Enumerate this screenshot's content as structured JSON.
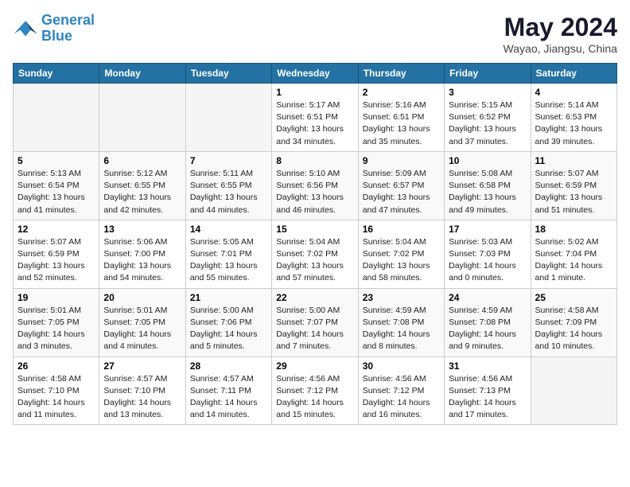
{
  "header": {
    "logo_line1": "General",
    "logo_line2": "Blue",
    "month_title": "May 2024",
    "location": "Wayao, Jiangsu, China"
  },
  "days_of_week": [
    "Sunday",
    "Monday",
    "Tuesday",
    "Wednesday",
    "Thursday",
    "Friday",
    "Saturday"
  ],
  "weeks": [
    [
      {
        "num": "",
        "info": ""
      },
      {
        "num": "",
        "info": ""
      },
      {
        "num": "",
        "info": ""
      },
      {
        "num": "1",
        "info": "Sunrise: 5:17 AM\nSunset: 6:51 PM\nDaylight: 13 hours\nand 34 minutes."
      },
      {
        "num": "2",
        "info": "Sunrise: 5:16 AM\nSunset: 6:51 PM\nDaylight: 13 hours\nand 35 minutes."
      },
      {
        "num": "3",
        "info": "Sunrise: 5:15 AM\nSunset: 6:52 PM\nDaylight: 13 hours\nand 37 minutes."
      },
      {
        "num": "4",
        "info": "Sunrise: 5:14 AM\nSunset: 6:53 PM\nDaylight: 13 hours\nand 39 minutes."
      }
    ],
    [
      {
        "num": "5",
        "info": "Sunrise: 5:13 AM\nSunset: 6:54 PM\nDaylight: 13 hours\nand 41 minutes."
      },
      {
        "num": "6",
        "info": "Sunrise: 5:12 AM\nSunset: 6:55 PM\nDaylight: 13 hours\nand 42 minutes."
      },
      {
        "num": "7",
        "info": "Sunrise: 5:11 AM\nSunset: 6:55 PM\nDaylight: 13 hours\nand 44 minutes."
      },
      {
        "num": "8",
        "info": "Sunrise: 5:10 AM\nSunset: 6:56 PM\nDaylight: 13 hours\nand 46 minutes."
      },
      {
        "num": "9",
        "info": "Sunrise: 5:09 AM\nSunset: 6:57 PM\nDaylight: 13 hours\nand 47 minutes."
      },
      {
        "num": "10",
        "info": "Sunrise: 5:08 AM\nSunset: 6:58 PM\nDaylight: 13 hours\nand 49 minutes."
      },
      {
        "num": "11",
        "info": "Sunrise: 5:07 AM\nSunset: 6:59 PM\nDaylight: 13 hours\nand 51 minutes."
      }
    ],
    [
      {
        "num": "12",
        "info": "Sunrise: 5:07 AM\nSunset: 6:59 PM\nDaylight: 13 hours\nand 52 minutes."
      },
      {
        "num": "13",
        "info": "Sunrise: 5:06 AM\nSunset: 7:00 PM\nDaylight: 13 hours\nand 54 minutes."
      },
      {
        "num": "14",
        "info": "Sunrise: 5:05 AM\nSunset: 7:01 PM\nDaylight: 13 hours\nand 55 minutes."
      },
      {
        "num": "15",
        "info": "Sunrise: 5:04 AM\nSunset: 7:02 PM\nDaylight: 13 hours\nand 57 minutes."
      },
      {
        "num": "16",
        "info": "Sunrise: 5:04 AM\nSunset: 7:02 PM\nDaylight: 13 hours\nand 58 minutes."
      },
      {
        "num": "17",
        "info": "Sunrise: 5:03 AM\nSunset: 7:03 PM\nDaylight: 14 hours\nand 0 minutes."
      },
      {
        "num": "18",
        "info": "Sunrise: 5:02 AM\nSunset: 7:04 PM\nDaylight: 14 hours\nand 1 minute."
      }
    ],
    [
      {
        "num": "19",
        "info": "Sunrise: 5:01 AM\nSunset: 7:05 PM\nDaylight: 14 hours\nand 3 minutes."
      },
      {
        "num": "20",
        "info": "Sunrise: 5:01 AM\nSunset: 7:05 PM\nDaylight: 14 hours\nand 4 minutes."
      },
      {
        "num": "21",
        "info": "Sunrise: 5:00 AM\nSunset: 7:06 PM\nDaylight: 14 hours\nand 5 minutes."
      },
      {
        "num": "22",
        "info": "Sunrise: 5:00 AM\nSunset: 7:07 PM\nDaylight: 14 hours\nand 7 minutes."
      },
      {
        "num": "23",
        "info": "Sunrise: 4:59 AM\nSunset: 7:08 PM\nDaylight: 14 hours\nand 8 minutes."
      },
      {
        "num": "24",
        "info": "Sunrise: 4:59 AM\nSunset: 7:08 PM\nDaylight: 14 hours\nand 9 minutes."
      },
      {
        "num": "25",
        "info": "Sunrise: 4:58 AM\nSunset: 7:09 PM\nDaylight: 14 hours\nand 10 minutes."
      }
    ],
    [
      {
        "num": "26",
        "info": "Sunrise: 4:58 AM\nSunset: 7:10 PM\nDaylight: 14 hours\nand 11 minutes."
      },
      {
        "num": "27",
        "info": "Sunrise: 4:57 AM\nSunset: 7:10 PM\nDaylight: 14 hours\nand 13 minutes."
      },
      {
        "num": "28",
        "info": "Sunrise: 4:57 AM\nSunset: 7:11 PM\nDaylight: 14 hours\nand 14 minutes."
      },
      {
        "num": "29",
        "info": "Sunrise: 4:56 AM\nSunset: 7:12 PM\nDaylight: 14 hours\nand 15 minutes."
      },
      {
        "num": "30",
        "info": "Sunrise: 4:56 AM\nSunset: 7:12 PM\nDaylight: 14 hours\nand 16 minutes."
      },
      {
        "num": "31",
        "info": "Sunrise: 4:56 AM\nSunset: 7:13 PM\nDaylight: 14 hours\nand 17 minutes."
      },
      {
        "num": "",
        "info": ""
      }
    ]
  ]
}
